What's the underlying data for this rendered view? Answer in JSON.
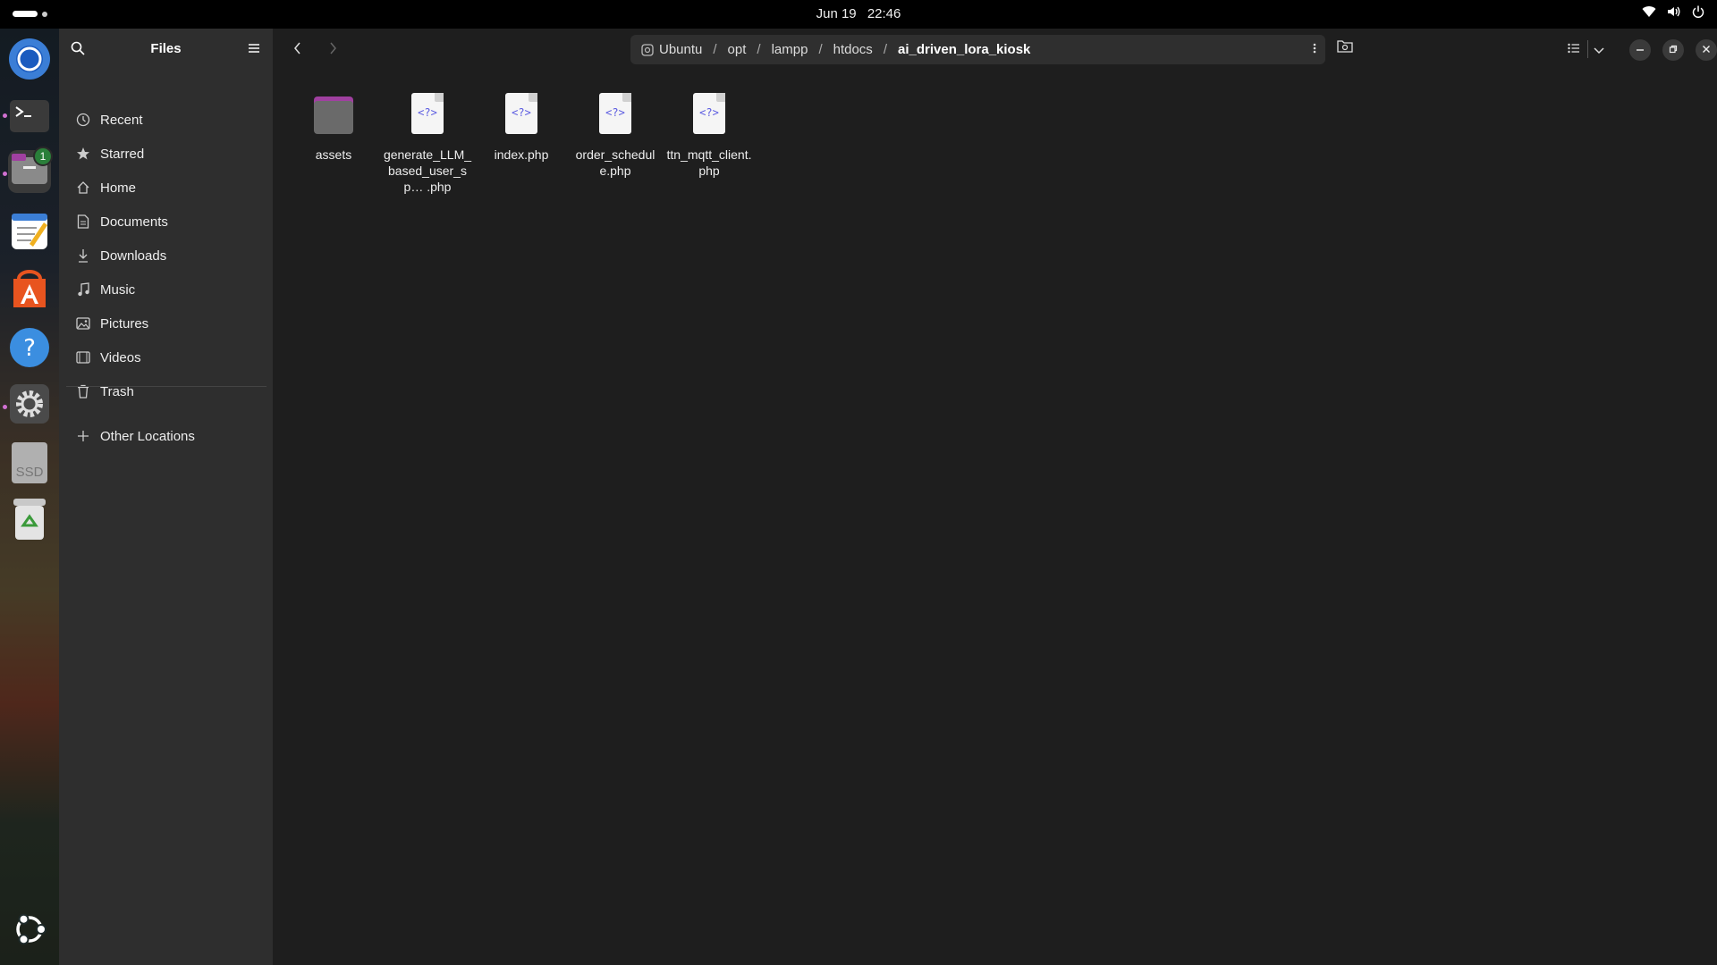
{
  "topbar": {
    "date": "Jun 19",
    "time": "22:46"
  },
  "dock": {
    "items": [
      {
        "name": "chromium",
        "icon": "chromium-icon"
      },
      {
        "name": "terminal",
        "icon": "terminal-icon"
      },
      {
        "name": "files",
        "icon": "files-icon",
        "badge": "1"
      },
      {
        "name": "text-editor",
        "icon": "text-editor-icon"
      },
      {
        "name": "app-center",
        "icon": "app-center-icon"
      },
      {
        "name": "help",
        "icon": "help-icon"
      },
      {
        "name": "settings",
        "icon": "settings-icon"
      },
      {
        "name": "ssd",
        "icon": "ssd-drive-icon",
        "label": "SSD"
      },
      {
        "name": "trash",
        "icon": "trash-icon"
      },
      {
        "name": "show-apps",
        "icon": "ubuntu-logo-icon"
      }
    ]
  },
  "sidebar": {
    "title": "Files",
    "items": [
      {
        "label": "Recent",
        "icon": "clock-icon"
      },
      {
        "label": "Starred",
        "icon": "star-icon"
      },
      {
        "label": "Home",
        "icon": "home-icon"
      },
      {
        "label": "Documents",
        "icon": "document-icon"
      },
      {
        "label": "Downloads",
        "icon": "download-icon"
      },
      {
        "label": "Music",
        "icon": "music-icon"
      },
      {
        "label": "Pictures",
        "icon": "picture-icon"
      },
      {
        "label": "Videos",
        "icon": "video-icon"
      },
      {
        "label": "Trash",
        "icon": "trash-icon"
      }
    ],
    "other_locations": "Other Locations"
  },
  "pathbar": {
    "segments": [
      "Ubuntu",
      "opt",
      "lampp",
      "htdocs"
    ],
    "current": "ai_driven_lora_kiosk"
  },
  "files": [
    {
      "type": "folder",
      "name": "assets"
    },
    {
      "type": "php",
      "name": "generate_LLM_based_user_sp… .php",
      "icon_text": "<?>"
    },
    {
      "type": "php",
      "name": "index.php",
      "icon_text": "<?>"
    },
    {
      "type": "php",
      "name": "order_schedule.php",
      "icon_text": "<?>"
    },
    {
      "type": "php",
      "name": "ttn_mqtt_client.php",
      "icon_text": "<?>"
    }
  ]
}
